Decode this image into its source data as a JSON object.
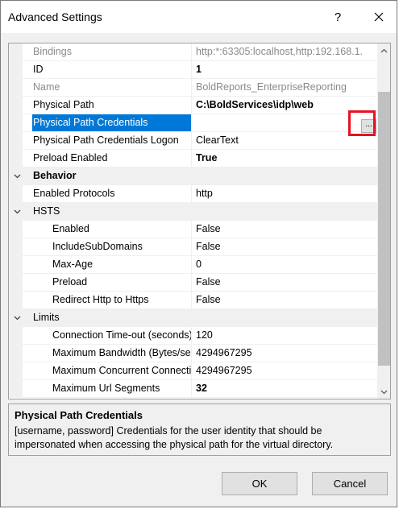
{
  "window": {
    "title": "Advanced Settings",
    "help_label": "?",
    "ellipsis_label": "..."
  },
  "rows": [
    {
      "kind": "prop",
      "name": "Bindings",
      "value": "http:*:63305:localhost,http:192.168.1.",
      "disabled": true
    },
    {
      "kind": "prop",
      "name": "ID",
      "value": "1",
      "bold": true
    },
    {
      "kind": "prop",
      "name": "Name",
      "value": "BoldReports_EnterpriseReporting",
      "disabled": true
    },
    {
      "kind": "prop",
      "name": "Physical Path",
      "value": "C:\\BoldServices\\idp\\web",
      "bold": true
    },
    {
      "kind": "prop",
      "name": "Physical Path Credentials",
      "value": "",
      "selected": true,
      "ellipsis": true
    },
    {
      "kind": "prop",
      "name": "Physical Path Credentials Logon",
      "value": "ClearText"
    },
    {
      "kind": "prop",
      "name": "Preload Enabled",
      "value": "True",
      "bold": true
    },
    {
      "kind": "category",
      "name": "Behavior",
      "expanded": true
    },
    {
      "kind": "prop",
      "name": "Enabled Protocols",
      "value": "http"
    },
    {
      "kind": "category",
      "name": "HSTS",
      "expanded": true,
      "plain": true
    },
    {
      "kind": "prop",
      "sub": true,
      "name": "Enabled",
      "value": "False"
    },
    {
      "kind": "prop",
      "sub": true,
      "name": "IncludeSubDomains",
      "value": "False"
    },
    {
      "kind": "prop",
      "sub": true,
      "name": "Max-Age",
      "value": "0"
    },
    {
      "kind": "prop",
      "sub": true,
      "name": "Preload",
      "value": "False"
    },
    {
      "kind": "prop",
      "sub": true,
      "name": "Redirect Http to Https",
      "value": "False"
    },
    {
      "kind": "category",
      "name": "Limits",
      "expanded": true,
      "plain": true
    },
    {
      "kind": "prop",
      "sub": true,
      "name": "Connection Time-out (seconds)",
      "value": "120"
    },
    {
      "kind": "prop",
      "sub": true,
      "name": "Maximum Bandwidth (Bytes/second)",
      "value": "4294967295"
    },
    {
      "kind": "prop",
      "sub": true,
      "name": "Maximum Concurrent Connections",
      "value": "4294967295"
    },
    {
      "kind": "prop",
      "sub": true,
      "name": "Maximum Url Segments",
      "value": "32",
      "bold": true
    }
  ],
  "description": {
    "title": "Physical Path Credentials",
    "text": "[username, password] Credentials for the user identity that should be impersonated when accessing the physical path for the virtual directory."
  },
  "buttons": {
    "ok": "OK",
    "cancel": "Cancel"
  },
  "colors": {
    "selection": "#0078d7",
    "highlight_box": "#e81123"
  }
}
